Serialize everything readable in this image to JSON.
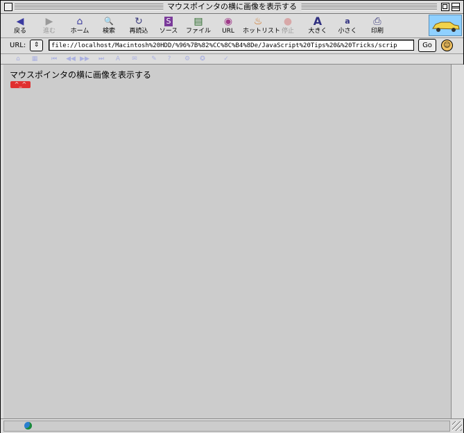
{
  "window": {
    "title": "マウスポインタの横に画像を表示する"
  },
  "toolbar": {
    "buttons": [
      {
        "label": "戻る",
        "icon": "◀",
        "enabled": true
      },
      {
        "label": "進む",
        "icon": "▶",
        "enabled": false
      },
      {
        "label": "ホーム",
        "icon": "⌂",
        "enabled": true
      },
      {
        "label": "検索",
        "icon": "🔍",
        "enabled": true
      },
      {
        "label": "再読込",
        "icon": "↻",
        "enabled": true
      },
      {
        "label": "ソース",
        "icon": "S",
        "enabled": true
      },
      {
        "label": "ファイル",
        "icon": "▤",
        "enabled": true
      },
      {
        "label": "URL",
        "icon": "◉",
        "enabled": true
      },
      {
        "label": "ホットリスト",
        "icon": "♨",
        "enabled": true
      },
      {
        "label": "停止",
        "icon": "●",
        "enabled": false
      },
      {
        "label": "大きく",
        "icon": "A",
        "enabled": true
      },
      {
        "label": "小さく",
        "icon": "a",
        "enabled": true
      },
      {
        "label": "印刷",
        "icon": "⎙",
        "enabled": true
      }
    ]
  },
  "urlbar": {
    "label": "URL:",
    "popup": "⇕",
    "value": "file://localhost/Macintosh%20HDD/%96%7B%82%CC%8C%B4%8De/JavaScript%20Tips%20&%20Tricks/scrip",
    "go_label": "Go"
  },
  "content": {
    "heading": "マウスポインタの横に画像を表示する",
    "image_text": "^_^"
  },
  "colors": {
    "chrome": "#dddddd",
    "page_background": "#cccccc",
    "image_red": "#e03030"
  }
}
